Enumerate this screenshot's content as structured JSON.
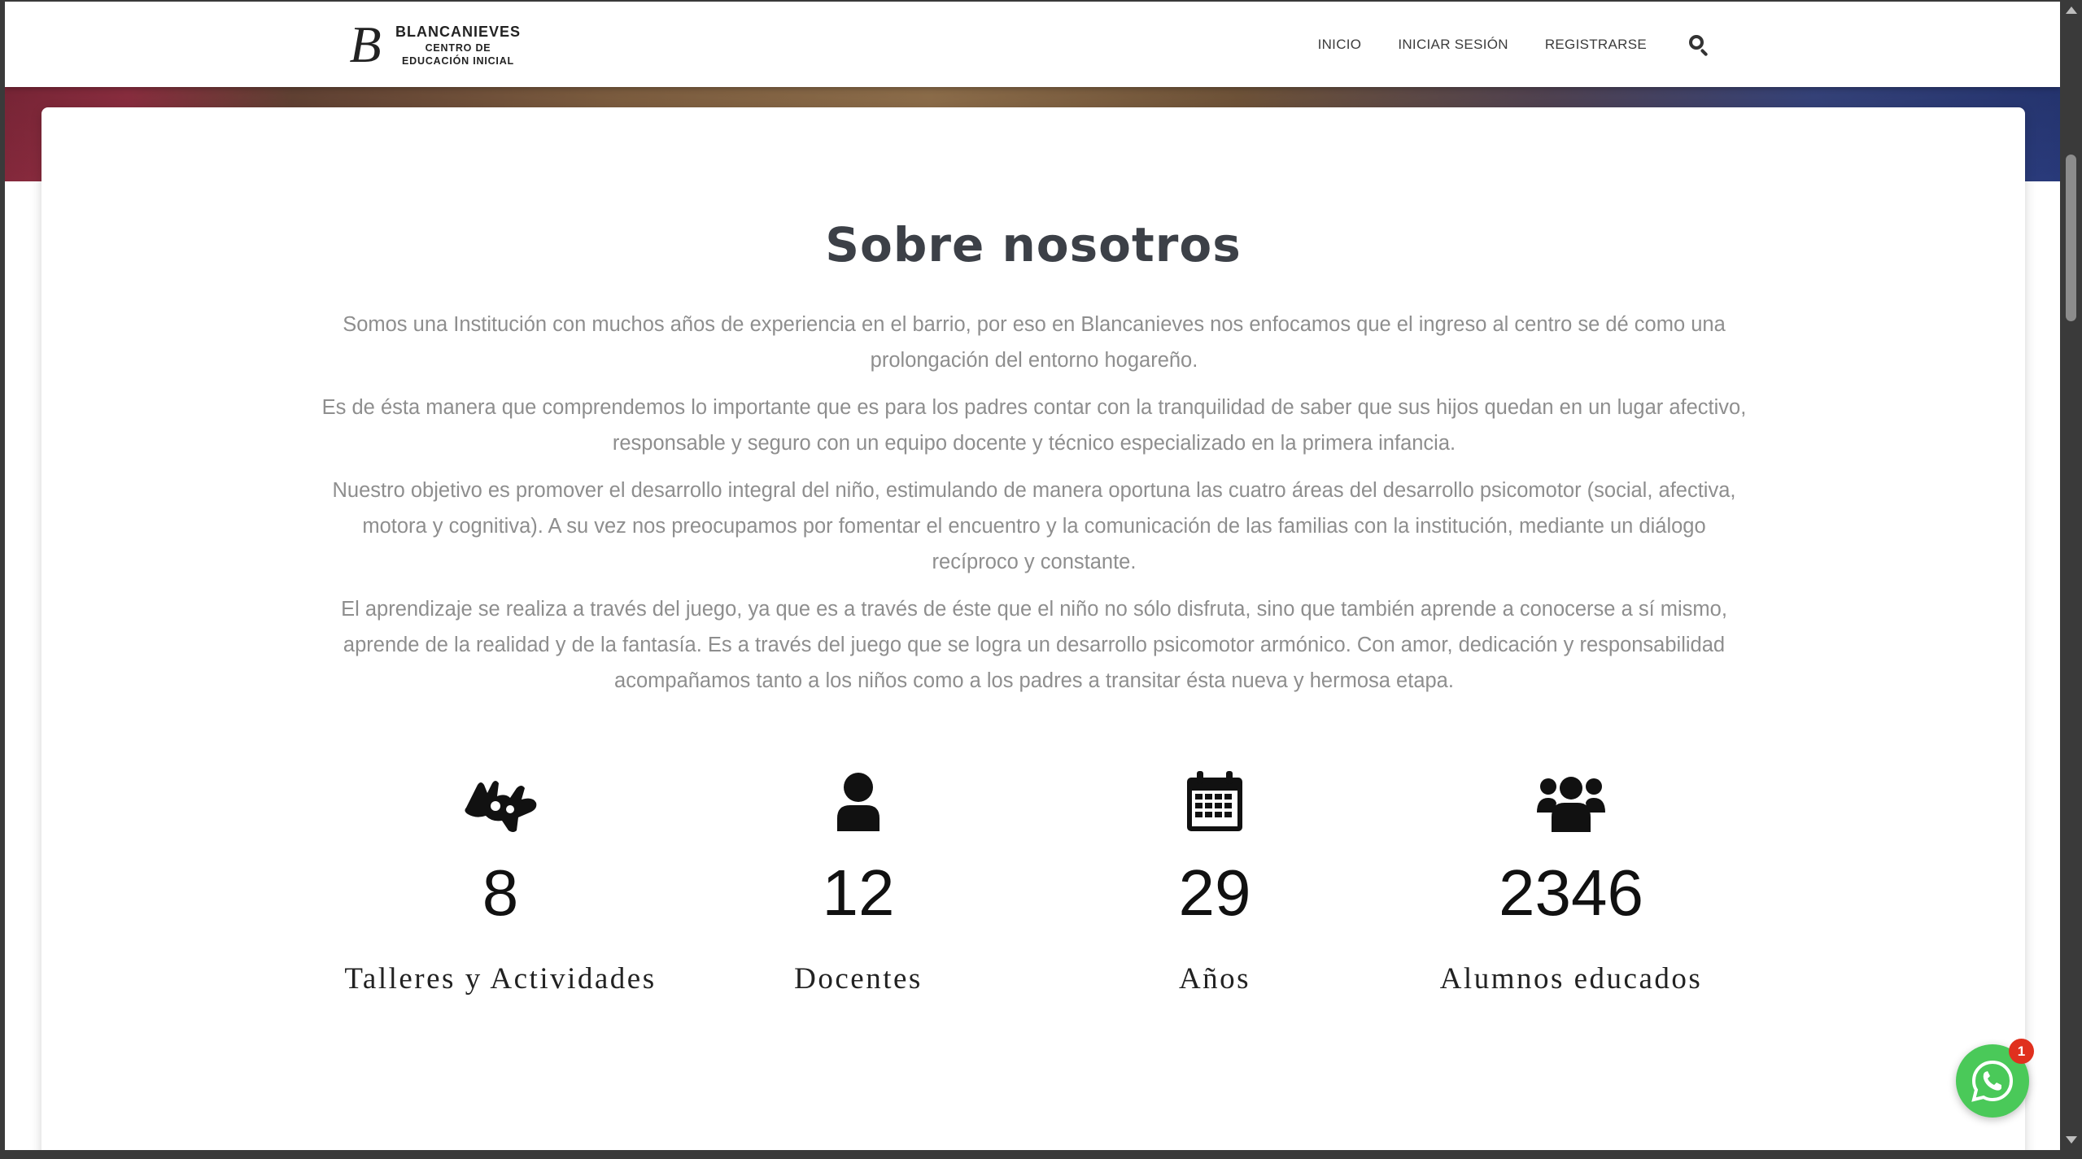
{
  "brand": {
    "mark": "B",
    "line1": "BLANCANIEVES",
    "line2": "CENTRO DE",
    "line3": "EDUCACIÓN INICIAL"
  },
  "nav": {
    "items": [
      "INICIO",
      "INICIAR SESIÓN",
      "REGISTRARSE"
    ],
    "search_icon": "search-icon"
  },
  "about": {
    "title": "Sobre nosotros",
    "paragraphs": [
      "Somos una Institución con muchos años de experiencia en el barrio, por eso en Blancanieves nos enfocamos que el ingreso al centro se dé como una prolongación del entorno hogareño.",
      "Es de ésta manera que comprendemos lo importante que es para los padres contar con la tranquilidad de saber que sus hijos quedan en un lugar afectivo, responsable y seguro con un equipo docente y técnico especializado en la primera infancia.",
      "Nuestro objetivo es promover el desarrollo integral del niño, estimulando de manera oportuna las cuatro áreas del desarrollo psicomotor (social, afectiva, motora y cognitiva). A su vez nos preocupamos por fomentar el encuentro y la comunicación de las familias con la institución, mediante un diálogo recíproco y constante.",
      "El aprendizaje se realiza a través del juego, ya que es a través de éste que el niño no sólo disfruta, sino que también aprende a conocerse a sí mismo, aprende de la realidad y de la fantasía. Es a través del juego que se logra un desarrollo psicomotor armónico. Con amor, dedicación y responsabilidad acompañamos tanto a los niños como a los padres a transitar ésta nueva y hermosa etapa."
    ]
  },
  "stats": [
    {
      "icon": "sign-language-icon",
      "value": "8",
      "label": "Talleres y Actividades"
    },
    {
      "icon": "user-icon",
      "value": "12",
      "label": "Docentes"
    },
    {
      "icon": "calendar-icon",
      "value": "29",
      "label": "Años"
    },
    {
      "icon": "users-group-icon",
      "value": "2346",
      "label": "Alumnos educados"
    }
  ],
  "whatsapp": {
    "icon": "whatsapp-icon",
    "badge": "1",
    "color": "#4ac959",
    "badge_color": "#e0301e"
  }
}
